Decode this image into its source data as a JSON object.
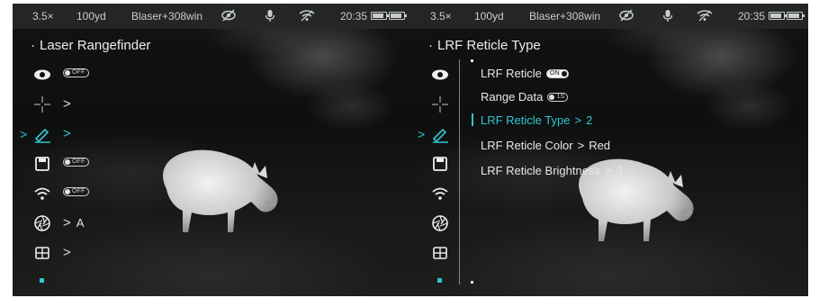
{
  "status_bar": {
    "zoom": "3.5×",
    "distance": "100yd",
    "profile": "Blaser+308win",
    "time": "20:35"
  },
  "left_screen": {
    "title": "Laser Rangefinder",
    "rows": [
      {
        "icon": "eye-icon",
        "toggle": "OFF",
        "chevron": "",
        "value": ""
      },
      {
        "icon": "crosshair-icon",
        "toggle": "",
        "chevron": ">",
        "value": ""
      },
      {
        "icon": "pencil-icon",
        "toggle": "",
        "chevron": ">",
        "value": ""
      },
      {
        "icon": "save-icon",
        "toggle": "OFF",
        "chevron": "",
        "value": ""
      },
      {
        "icon": "wifi-icon",
        "toggle": "OFF",
        "chevron": "",
        "value": ""
      },
      {
        "icon": "aperture-icon",
        "toggle": "",
        "chevron": ">",
        "value": "A"
      },
      {
        "icon": "grid-icon",
        "toggle": "",
        "chevron": ">",
        "value": ""
      }
    ],
    "selected_marker": ">"
  },
  "right_screen": {
    "title": "LRF Reticle Type",
    "selected_marker": ">",
    "submenu": [
      {
        "label": "LRF Reticle",
        "toggle": "ON",
        "value": ""
      },
      {
        "label": "Range Data",
        "toggle": "1S",
        "value": ""
      },
      {
        "label": "LRF Reticle Type",
        "chevron": ">",
        "value": "2"
      },
      {
        "label": "LRF Reticle Color",
        "chevron": ">",
        "value": "Red"
      },
      {
        "label": "LRF Reticle Brightness",
        "chevron": ">",
        "value": "3"
      }
    ]
  },
  "colors": {
    "accent": "#2fc6d2",
    "text": "#ececec",
    "statusbar": "#262828"
  }
}
